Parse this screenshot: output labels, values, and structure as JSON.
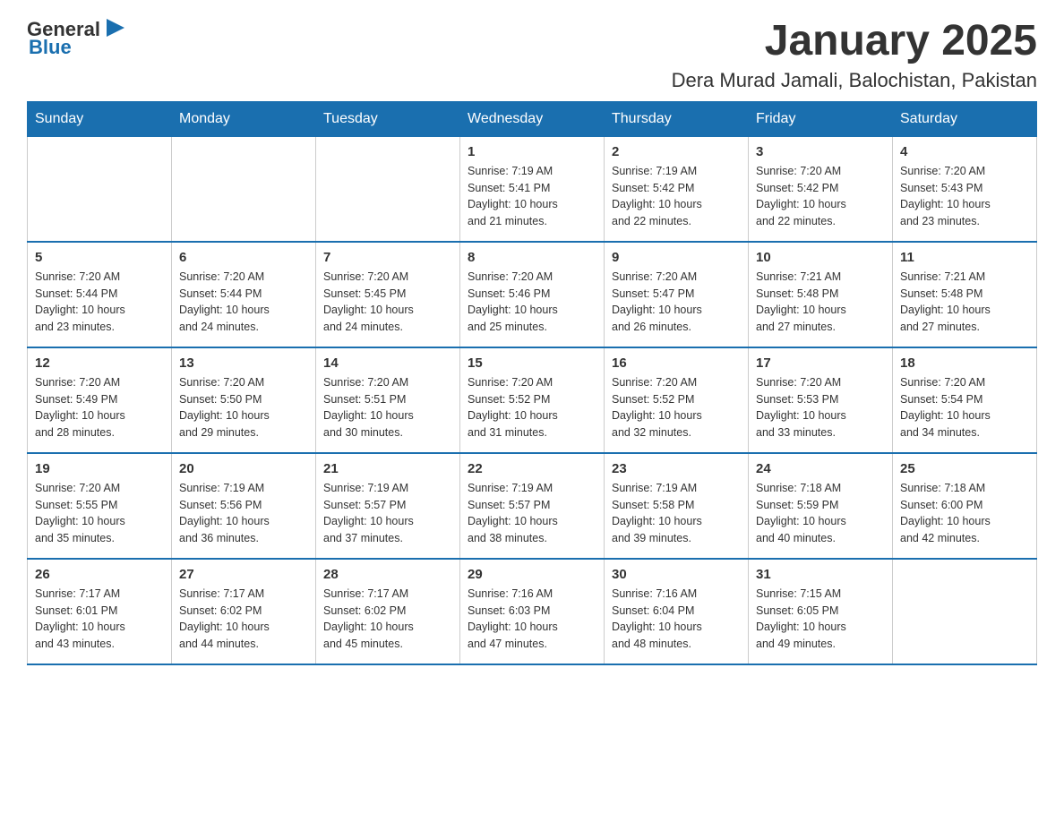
{
  "logo": {
    "text_general": "General",
    "text_blue": "Blue",
    "arrow_color": "#1a6faf"
  },
  "title": "January 2025",
  "subtitle": "Dera Murad Jamali, Balochistan, Pakistan",
  "days_of_week": [
    "Sunday",
    "Monday",
    "Tuesday",
    "Wednesday",
    "Thursday",
    "Friday",
    "Saturday"
  ],
  "weeks": [
    [
      {
        "day": "",
        "info": ""
      },
      {
        "day": "",
        "info": ""
      },
      {
        "day": "",
        "info": ""
      },
      {
        "day": "1",
        "info": "Sunrise: 7:19 AM\nSunset: 5:41 PM\nDaylight: 10 hours\nand 21 minutes."
      },
      {
        "day": "2",
        "info": "Sunrise: 7:19 AM\nSunset: 5:42 PM\nDaylight: 10 hours\nand 22 minutes."
      },
      {
        "day": "3",
        "info": "Sunrise: 7:20 AM\nSunset: 5:42 PM\nDaylight: 10 hours\nand 22 minutes."
      },
      {
        "day": "4",
        "info": "Sunrise: 7:20 AM\nSunset: 5:43 PM\nDaylight: 10 hours\nand 23 minutes."
      }
    ],
    [
      {
        "day": "5",
        "info": "Sunrise: 7:20 AM\nSunset: 5:44 PM\nDaylight: 10 hours\nand 23 minutes."
      },
      {
        "day": "6",
        "info": "Sunrise: 7:20 AM\nSunset: 5:44 PM\nDaylight: 10 hours\nand 24 minutes."
      },
      {
        "day": "7",
        "info": "Sunrise: 7:20 AM\nSunset: 5:45 PM\nDaylight: 10 hours\nand 24 minutes."
      },
      {
        "day": "8",
        "info": "Sunrise: 7:20 AM\nSunset: 5:46 PM\nDaylight: 10 hours\nand 25 minutes."
      },
      {
        "day": "9",
        "info": "Sunrise: 7:20 AM\nSunset: 5:47 PM\nDaylight: 10 hours\nand 26 minutes."
      },
      {
        "day": "10",
        "info": "Sunrise: 7:21 AM\nSunset: 5:48 PM\nDaylight: 10 hours\nand 27 minutes."
      },
      {
        "day": "11",
        "info": "Sunrise: 7:21 AM\nSunset: 5:48 PM\nDaylight: 10 hours\nand 27 minutes."
      }
    ],
    [
      {
        "day": "12",
        "info": "Sunrise: 7:20 AM\nSunset: 5:49 PM\nDaylight: 10 hours\nand 28 minutes."
      },
      {
        "day": "13",
        "info": "Sunrise: 7:20 AM\nSunset: 5:50 PM\nDaylight: 10 hours\nand 29 minutes."
      },
      {
        "day": "14",
        "info": "Sunrise: 7:20 AM\nSunset: 5:51 PM\nDaylight: 10 hours\nand 30 minutes."
      },
      {
        "day": "15",
        "info": "Sunrise: 7:20 AM\nSunset: 5:52 PM\nDaylight: 10 hours\nand 31 minutes."
      },
      {
        "day": "16",
        "info": "Sunrise: 7:20 AM\nSunset: 5:52 PM\nDaylight: 10 hours\nand 32 minutes."
      },
      {
        "day": "17",
        "info": "Sunrise: 7:20 AM\nSunset: 5:53 PM\nDaylight: 10 hours\nand 33 minutes."
      },
      {
        "day": "18",
        "info": "Sunrise: 7:20 AM\nSunset: 5:54 PM\nDaylight: 10 hours\nand 34 minutes."
      }
    ],
    [
      {
        "day": "19",
        "info": "Sunrise: 7:20 AM\nSunset: 5:55 PM\nDaylight: 10 hours\nand 35 minutes."
      },
      {
        "day": "20",
        "info": "Sunrise: 7:19 AM\nSunset: 5:56 PM\nDaylight: 10 hours\nand 36 minutes."
      },
      {
        "day": "21",
        "info": "Sunrise: 7:19 AM\nSunset: 5:57 PM\nDaylight: 10 hours\nand 37 minutes."
      },
      {
        "day": "22",
        "info": "Sunrise: 7:19 AM\nSunset: 5:57 PM\nDaylight: 10 hours\nand 38 minutes."
      },
      {
        "day": "23",
        "info": "Sunrise: 7:19 AM\nSunset: 5:58 PM\nDaylight: 10 hours\nand 39 minutes."
      },
      {
        "day": "24",
        "info": "Sunrise: 7:18 AM\nSunset: 5:59 PM\nDaylight: 10 hours\nand 40 minutes."
      },
      {
        "day": "25",
        "info": "Sunrise: 7:18 AM\nSunset: 6:00 PM\nDaylight: 10 hours\nand 42 minutes."
      }
    ],
    [
      {
        "day": "26",
        "info": "Sunrise: 7:17 AM\nSunset: 6:01 PM\nDaylight: 10 hours\nand 43 minutes."
      },
      {
        "day": "27",
        "info": "Sunrise: 7:17 AM\nSunset: 6:02 PM\nDaylight: 10 hours\nand 44 minutes."
      },
      {
        "day": "28",
        "info": "Sunrise: 7:17 AM\nSunset: 6:02 PM\nDaylight: 10 hours\nand 45 minutes."
      },
      {
        "day": "29",
        "info": "Sunrise: 7:16 AM\nSunset: 6:03 PM\nDaylight: 10 hours\nand 47 minutes."
      },
      {
        "day": "30",
        "info": "Sunrise: 7:16 AM\nSunset: 6:04 PM\nDaylight: 10 hours\nand 48 minutes."
      },
      {
        "day": "31",
        "info": "Sunrise: 7:15 AM\nSunset: 6:05 PM\nDaylight: 10 hours\nand 49 minutes."
      },
      {
        "day": "",
        "info": ""
      }
    ]
  ]
}
